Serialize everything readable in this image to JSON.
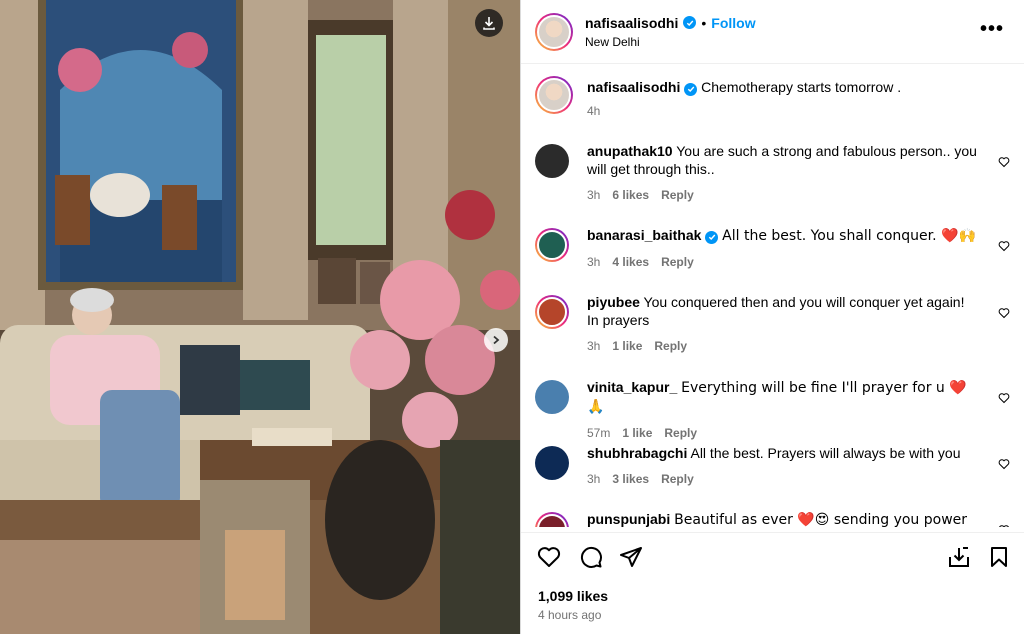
{
  "post": {
    "username": "nafisaalisodhi",
    "follow_label": "Follow",
    "separator": "•",
    "location": "New Delhi",
    "caption": "Chemotherapy starts tomorrow .",
    "caption_time": "4h",
    "likes": "1,099 likes",
    "time_ago": "4 hours ago"
  },
  "comments": [
    {
      "user": "anupathak10",
      "text": "You are such a strong and fabulous person.. you will get through this..",
      "time": "3h",
      "likes": "6 likes",
      "reply": "Reply",
      "avatar_color": "#2b2b2b"
    },
    {
      "user": "banarasi_baithak",
      "verified": true,
      "text": "All the best. You shall conquer. ❤️🙌",
      "time": "3h",
      "likes": "4 likes",
      "reply": "Reply",
      "avatar_color": "#1f5f52"
    },
    {
      "user": "piyubee",
      "text": "You conquered then and you will conquer yet again! In prayers",
      "time": "3h",
      "likes": "1 like",
      "reply": "Reply",
      "avatar_color": "#b5452a"
    },
    {
      "user": "vinita_kapur_",
      "text": "Everything will be fine I'll prayer for u ❤️ 🙏",
      "time": "57m",
      "likes": "1 like",
      "reply": "Reply",
      "avatar_color": "#4a7fae"
    },
    {
      "user": "shubhrabagchi",
      "text": "All the best. Prayers will always be with you",
      "time": "3h",
      "likes": "3 likes",
      "reply": "Reply",
      "avatar_color": "#0d2a55"
    },
    {
      "user": "punspunjabi",
      "text": "Beautiful as ever ❤️😍 sending you power health",
      "avatar_color": "#7a1f2a"
    }
  ],
  "icons": {
    "download": "download-icon",
    "next": "chevron-right-icon",
    "more": "more-options-icon",
    "like": "heart-icon",
    "comment": "comment-icon",
    "share": "share-icon",
    "save": "bookmark-icon",
    "save_to": "save-to-icon"
  },
  "colors": {
    "accent": "#0095f6",
    "muted": "#737373",
    "verified": "#0095f6"
  }
}
